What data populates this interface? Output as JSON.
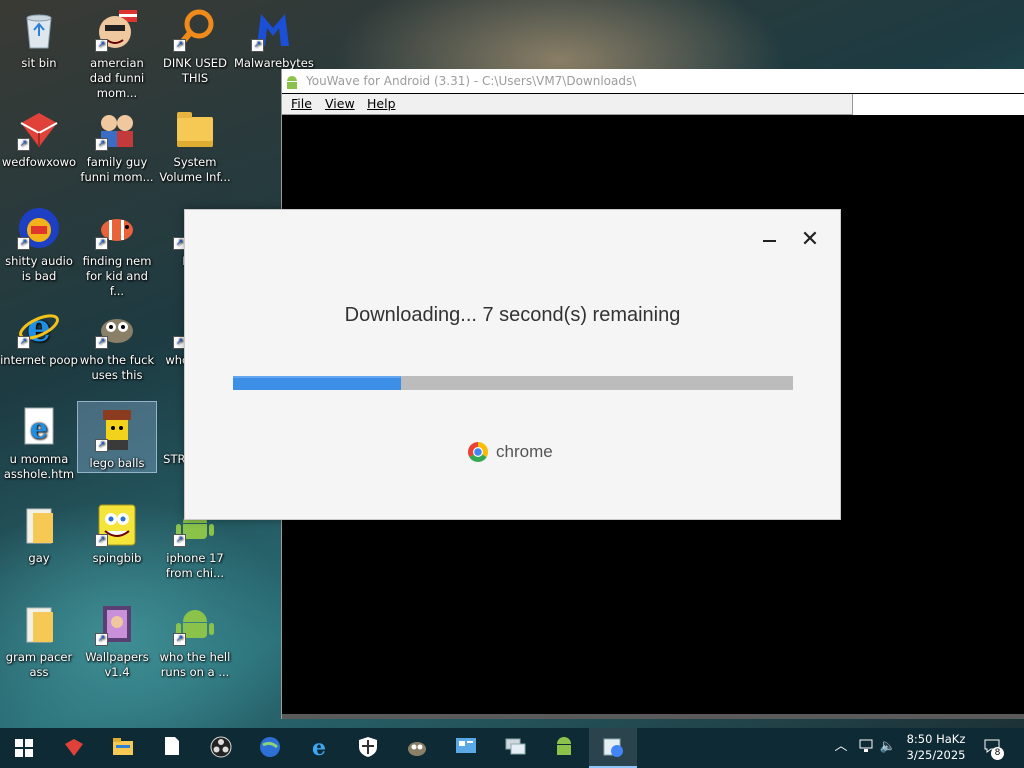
{
  "desktop": {
    "icons": [
      {
        "label": "sit bin"
      },
      {
        "label": "amercian dad funni mom..."
      },
      {
        "label": "DINK USED THIS"
      },
      {
        "label": "Malwarebytes"
      },
      {
        "label": "wedfowxowo"
      },
      {
        "label": "family guy funni mom..."
      },
      {
        "label": "System Volume Inf..."
      },
      {
        "label": "shitty audio is bad"
      },
      {
        "label": "finding nem for kid and f..."
      },
      {
        "label": "IN M"
      },
      {
        "label": "internet poop"
      },
      {
        "label": "who the fuck uses this"
      },
      {
        "label": "who share"
      },
      {
        "label": "u momma asshole.htm"
      },
      {
        "label": "lego balls"
      },
      {
        "label": "STRE EVER"
      },
      {
        "label": "gay"
      },
      {
        "label": "spingbib"
      },
      {
        "label": "iphone 17 from chi..."
      },
      {
        "label": "gram pacer ass"
      },
      {
        "label": "Wallpapers v1.4"
      },
      {
        "label": "who the hell runs on a ..."
      }
    ]
  },
  "youwave": {
    "title": "YouWave for Android (3.31) - C:\\Users\\VM7\\Downloads\\",
    "menu": [
      "File",
      "View",
      "Help"
    ]
  },
  "installer": {
    "status": "Downloading... 7 second(s) remaining",
    "progress_percent": 30,
    "brand": "chrome",
    "close_glyph": "✕"
  },
  "taskbar": {
    "time": "8:50 HaKz",
    "date": "3/25/2025",
    "notification_count": "8"
  },
  "colors": {
    "progress_fill": "#3d8ee6",
    "progress_track": "#bcbcbc",
    "taskbar_bg": "#0e2a35"
  }
}
